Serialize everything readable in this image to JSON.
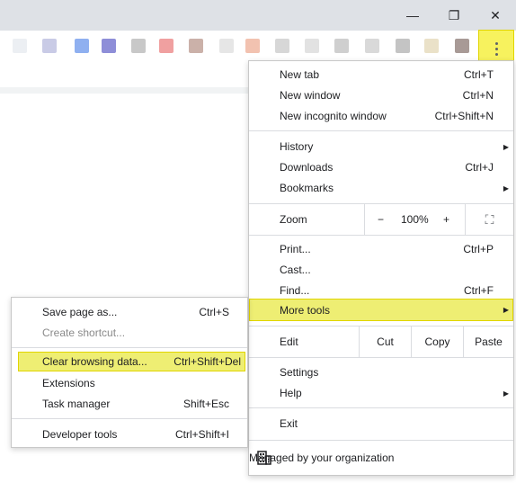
{
  "window_controls": {
    "minimize": "—",
    "maximize": "❐",
    "close": "✕"
  },
  "colors": {
    "highlight": "#eeee73",
    "highlight_border": "#e1d500"
  },
  "main_menu": {
    "new_tab": {
      "label": "New tab",
      "shortcut": "Ctrl+T"
    },
    "new_window": {
      "label": "New window",
      "shortcut": "Ctrl+N"
    },
    "new_incognito": {
      "label": "New incognito window",
      "shortcut": "Ctrl+Shift+N"
    },
    "history": {
      "label": "History"
    },
    "downloads": {
      "label": "Downloads",
      "shortcut": "Ctrl+J"
    },
    "bookmarks": {
      "label": "Bookmarks"
    },
    "zoom": {
      "label": "Zoom",
      "minus": "−",
      "value": "100%",
      "plus": "+",
      "fullscreen": "⛶"
    },
    "print": {
      "label": "Print...",
      "shortcut": "Ctrl+P"
    },
    "cast": {
      "label": "Cast..."
    },
    "find": {
      "label": "Find...",
      "shortcut": "Ctrl+F"
    },
    "more_tools": {
      "label": "More tools"
    },
    "edit": {
      "label": "Edit",
      "cut": "Cut",
      "copy": "Copy",
      "paste": "Paste"
    },
    "settings": {
      "label": "Settings"
    },
    "help": {
      "label": "Help"
    },
    "exit": {
      "label": "Exit"
    },
    "managed": {
      "label": "Managed by your organization"
    }
  },
  "more_tools_menu": {
    "save_page": {
      "label": "Save page as...",
      "shortcut": "Ctrl+S"
    },
    "create_shortcut": {
      "label": "Create shortcut..."
    },
    "clear_browsing": {
      "label": "Clear browsing data...",
      "shortcut": "Ctrl+Shift+Del"
    },
    "extensions": {
      "label": "Extensions"
    },
    "task_manager": {
      "label": "Task manager",
      "shortcut": "Shift+Esc"
    },
    "developer_tools": {
      "label": "Developer tools",
      "shortcut": "Ctrl+Shift+I"
    }
  }
}
